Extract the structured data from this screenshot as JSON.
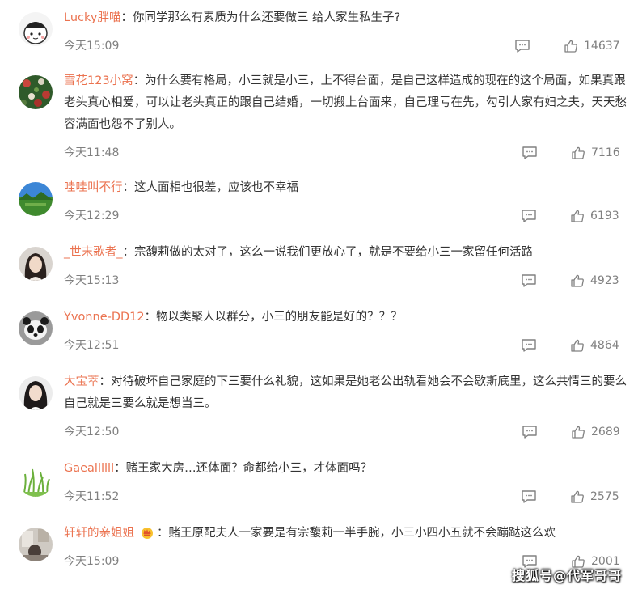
{
  "colors": {
    "username": "#eb7350",
    "meta": "#808080",
    "text": "#333333"
  },
  "separator": "：",
  "comments": [
    {
      "user": "Lucky胖喵",
      "text": "你同学那么有素质为什么还要做三 给人家生私生子?",
      "time": "今天15:09",
      "likes": "14637",
      "avatar": "cartoon-face"
    },
    {
      "user": "雪花123小窝",
      "text": "为什么要有格局，小三就是小三，上不得台面，是自己这样造成的现在的这个局面，如果真跟老头真心相爱，可以让老头真正的跟自己结婚，一切搬上台面来，自己理亏在先，勾引人家有妇之夫，天天愁容满面也怨不了别人。",
      "time": "今天11:48",
      "likes": "7116",
      "avatar": "flowers"
    },
    {
      "user": "哇哇叫不行",
      "text": "这人面相也很差，应该也不幸福",
      "time": "今天12:29",
      "likes": "6193",
      "avatar": "landscape"
    },
    {
      "user": "_世末歌者_",
      "text": "宗馥莉做的太对了，这么一说我们更放心了，就是不要给小三一家留任何活路",
      "time": "今天15:13",
      "likes": "4923",
      "avatar": "girl-portrait"
    },
    {
      "user": "Yvonne-DD12",
      "text": "物以类聚人以群分，小三的朋友能是好的？？？",
      "time": "今天12:51",
      "likes": "4864",
      "avatar": "panda"
    },
    {
      "user": "大宝萃",
      "text": "对待破坏自己家庭的下三要什么礼貌，这如果是她老公出轨看她会不会歇斯底里，这么共情三的要么自己就是三要么就是想当三。",
      "time": "今天12:50",
      "likes": "2689",
      "avatar": "woman-portrait"
    },
    {
      "user": "Gaeallllll",
      "text": "赌王家大房…还体面？命都给小三，才体面吗？",
      "time": "今天11:52",
      "likes": "2575",
      "avatar": "grass"
    },
    {
      "user": "轩轩的亲姐姐",
      "text": "赌王原配夫人一家要是有宗馥莉一半手腕，小三小四小五就不会蹦跶这么欢",
      "time": "今天15:09",
      "likes": "2001",
      "avatar": "room",
      "badge": "crown-badge-icon"
    }
  ],
  "watermark": "搜狐号@代军哥哥"
}
